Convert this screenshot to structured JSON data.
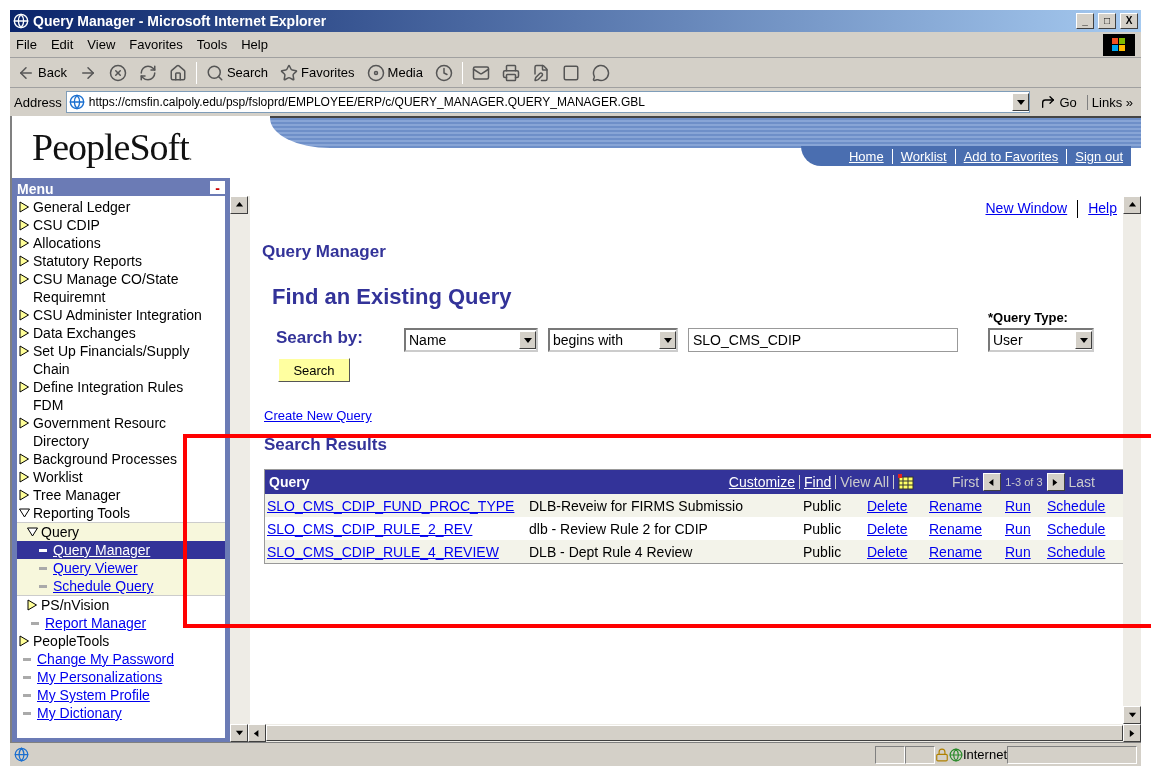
{
  "window": {
    "title": "Query Manager - Microsoft Internet Explorer",
    "controls": [
      "_",
      "□",
      "X"
    ]
  },
  "menubar": [
    "File",
    "Edit",
    "View",
    "Favorites",
    "Tools",
    "Help"
  ],
  "toolbar": [
    {
      "kind": "back",
      "label": "Back"
    },
    {
      "kind": "forward"
    },
    {
      "kind": "stop"
    },
    {
      "kind": "refresh"
    },
    {
      "kind": "home"
    },
    {
      "kind": "sep"
    },
    {
      "kind": "search",
      "label": "Search"
    },
    {
      "kind": "favorites",
      "label": "Favorites"
    },
    {
      "kind": "media",
      "label": "Media"
    },
    {
      "kind": "history"
    },
    {
      "kind": "sep"
    },
    {
      "kind": "mail"
    },
    {
      "kind": "print"
    },
    {
      "kind": "edit"
    },
    {
      "kind": "page"
    },
    {
      "kind": "discuss"
    }
  ],
  "address": {
    "label": "Address",
    "url": "https://cmsfin.calpoly.edu/psp/fsloprd/EMPLOYEE/ERP/c/QUERY_MANAGER.QUERY_MANAGER.GBL",
    "go": "Go",
    "links": "Links",
    "more": "»"
  },
  "logo": {
    "text": "PeopleSoft",
    "mark": "."
  },
  "header_links": [
    "Home",
    "Worklist",
    "Add to Favorites",
    "Sign out"
  ],
  "menu": {
    "title": "Menu",
    "collapse": "-",
    "items": [
      {
        "kind": "folder",
        "label": "General Ledger",
        "expanded": false
      },
      {
        "kind": "folder",
        "label": "CSU CDIP",
        "expanded": false
      },
      {
        "kind": "folder",
        "label": "Allocations",
        "expanded": false
      },
      {
        "kind": "folder",
        "label": "Statutory Reports",
        "expanded": false
      },
      {
        "kind": "folder",
        "label": "CSU Manage CO/State Requiremnt",
        "expanded": false
      },
      {
        "kind": "folder",
        "label": "CSU Administer Integration",
        "expanded": false
      },
      {
        "kind": "folder",
        "label": "Data Exchanges",
        "expanded": false
      },
      {
        "kind": "folder",
        "label": "Set Up Financials/Supply Chain",
        "expanded": false
      },
      {
        "kind": "folder",
        "label": "Define Integration Rules FDM",
        "expanded": false
      },
      {
        "kind": "folder",
        "label": "Government Resourc Directory",
        "expanded": false
      },
      {
        "kind": "folder",
        "label": "Background Processes",
        "expanded": false
      },
      {
        "kind": "folder",
        "label": "Worklist",
        "expanded": false
      },
      {
        "kind": "folder",
        "label": "Tree Manager",
        "expanded": false
      },
      {
        "kind": "folder",
        "label": "Reporting Tools",
        "expanded": true,
        "children": [
          {
            "kind": "folder",
            "label": "Query",
            "expanded": true,
            "children": [
              {
                "kind": "link",
                "label": "Query Manager",
                "selected": true
              },
              {
                "kind": "link",
                "label": "Query Viewer",
                "selected": false
              },
              {
                "kind": "link",
                "label": "Schedule Query",
                "selected": false
              }
            ]
          },
          {
            "kind": "folder",
            "label": "PS/nVision",
            "expanded": false
          },
          {
            "kind": "link",
            "label": "Report Manager",
            "selected": false
          }
        ]
      },
      {
        "kind": "folder",
        "label": "PeopleTools",
        "expanded": false
      },
      {
        "kind": "link",
        "label": "Change My Password",
        "selected": false
      },
      {
        "kind": "link",
        "label": "My Personalizations",
        "selected": false
      },
      {
        "kind": "link",
        "label": "My System Profile",
        "selected": false
      },
      {
        "kind": "link",
        "label": "My Dictionary",
        "selected": false
      }
    ]
  },
  "content": {
    "top_links": [
      "New Window",
      "Help"
    ],
    "page_title": "Query Manager",
    "heading": "Find an Existing Query",
    "search_by": {
      "label": "Search by:",
      "field": "Name",
      "operator": "begins with",
      "value": "SLO_CMS_CDIP"
    },
    "query_type": {
      "label": "*Query Type:",
      "value": "User"
    },
    "search_button": "Search",
    "create_link": "Create New Query",
    "results_title": "Search Results",
    "grid": {
      "title": "Query",
      "customize": "Customize",
      "find": "Find",
      "view_all": "View All",
      "first": "First",
      "range_text": "1-3 of 3",
      "last": "Last",
      "rows": [
        {
          "query": "SLO_CMS_CDIP_FUND_PROC_TYPE",
          "description": "DLB-Reveiw for FIRMS Submissio",
          "owner": "Public",
          "actions": [
            "Delete",
            "Rename",
            "Run",
            "Schedule"
          ]
        },
        {
          "query": "SLO_CMS_CDIP_RULE_2_REV",
          "description": "dlb - Review Rule 2 for CDIP",
          "owner": "Public",
          "actions": [
            "Delete",
            "Rename",
            "Run",
            "Schedule"
          ]
        },
        {
          "query": "SLO_CMS_CDIP_RULE_4_REVIEW",
          "description": "DLB - Dept Rule 4 Review",
          "owner": "Public",
          "actions": [
            "Delete",
            "Rename",
            "Run",
            "Schedule"
          ]
        }
      ]
    }
  },
  "annotation": {
    "highlight": true
  },
  "status_bar": {
    "zone": "Internet"
  }
}
